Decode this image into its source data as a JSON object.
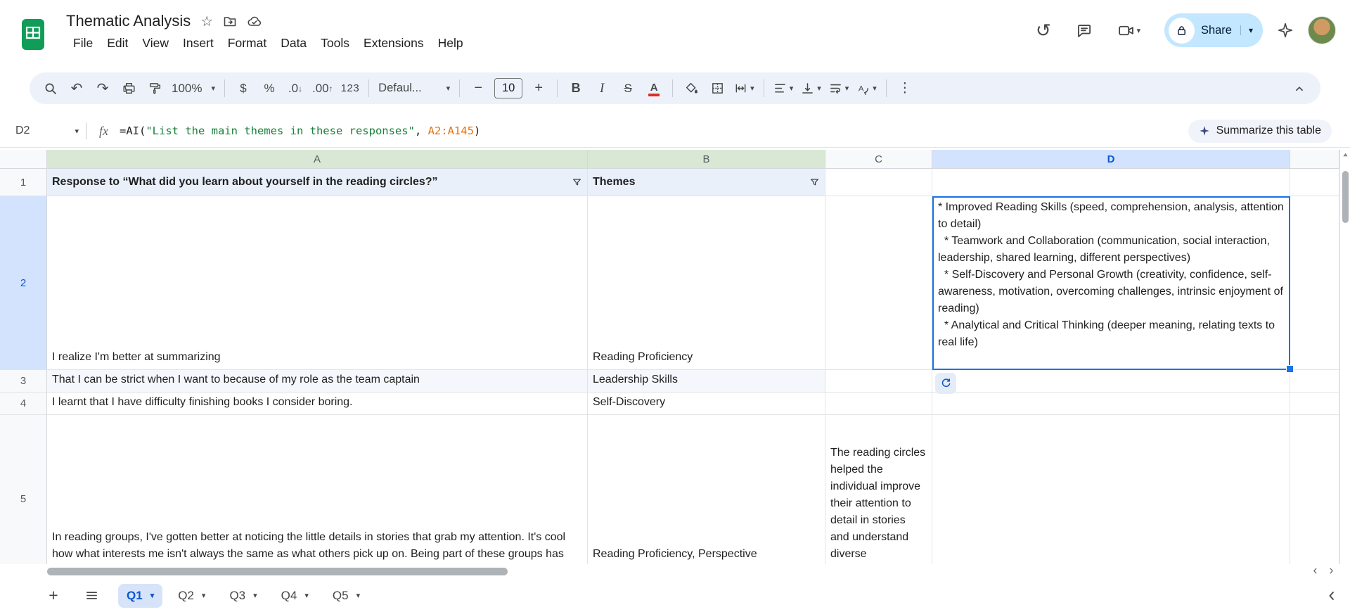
{
  "colors": {
    "accent_blue": "#1a73e8",
    "selected_header_bg": "#d3e3fd",
    "share_button_bg": "#c2e7ff",
    "table_header_green": "#d8e8d4",
    "formula_string_green": "#188038",
    "formula_range_orange": "#e8710a",
    "logo_green": "#0f9d58"
  },
  "app": {
    "title": "Thematic Analysis",
    "menus": [
      "File",
      "Edit",
      "View",
      "Insert",
      "Format",
      "Data",
      "Tools",
      "Extensions",
      "Help"
    ],
    "share_label": "Share"
  },
  "toolbar": {
    "zoom": "100%",
    "currency": "$",
    "percent": "%",
    "dec_decimal": ".0",
    "inc_decimal": ".00",
    "number_format": "123",
    "font_family": "Defaul...",
    "minus": "−",
    "font_size": "10",
    "plus": "+",
    "bold": "B",
    "italic": "I",
    "strike": "S",
    "text_color": "A",
    "more": "⋮"
  },
  "formula_bar": {
    "cell_ref": "D2",
    "fx_label": "fx",
    "formula": {
      "prefix": "=AI(",
      "string": "\"List the main themes in these responses\"",
      "separator": ", ",
      "range": "A2:A145",
      "suffix": ")"
    },
    "summarize_button": "Summarize this table"
  },
  "grid": {
    "column_headers": [
      "A",
      "B",
      "C",
      "D"
    ],
    "row_headers": [
      "1",
      "2",
      "3",
      "4",
      "5"
    ],
    "cells": {
      "A1": "Response to “What did you learn about yourself in the reading circles?”",
      "B1": "Themes",
      "A2": "I realize I'm better at summarizing",
      "B2": "Reading Proficiency",
      "D2": "* Improved Reading Skills (speed, comprehension, analysis, attention to detail)\n  * Teamwork and Collaboration (communication, social interaction, leadership, shared learning, different perspectives)\n  * Self-Discovery and Personal Growth (creativity, confidence, self-awareness, motivation, overcoming challenges, intrinsic enjoyment of reading)\n  * Analytical and Critical Thinking (deeper meaning, relating texts to real life)",
      "A3": "That I can be strict when I want to because of my role as the team captain",
      "B3": "Leadership Skills",
      "A4": "I learnt that I have difficulty finishing books I consider boring.",
      "B4": "Self-Discovery",
      "A5": "In reading groups, I've gotten better at noticing the little details in stories that grab my attention. It's cool how what interests me isn't always the same as what others pick up on. Being part of these groups has taught me more about stories and how everyone sees things a bit differently.",
      "B5": "Reading Proficiency, Perspective Diversification",
      "C5": "The reading circles helped the individual improve their attention to detail in stories and understand diverse perspectives"
    }
  },
  "sheet_tabs": {
    "add": "+",
    "tabs": [
      "Q1",
      "Q2",
      "Q3",
      "Q4",
      "Q5"
    ],
    "active_tab": "Q1"
  }
}
